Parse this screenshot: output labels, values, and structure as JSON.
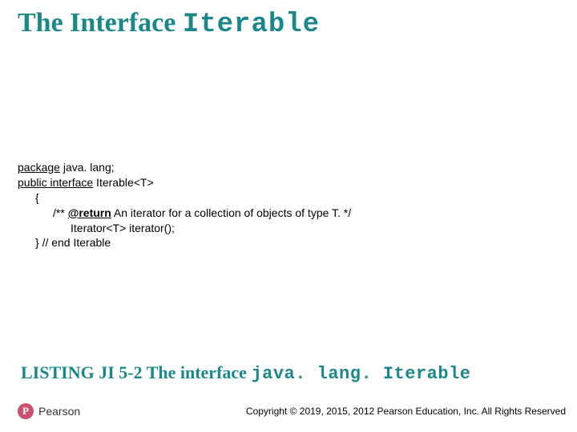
{
  "title": {
    "prefix": "The Interface ",
    "mono": "Iterable"
  },
  "code": {
    "l1a": "package",
    "l1b": " java. lang;",
    "l2a": "public interface",
    "l2b": " Iterable<T>",
    "l3": "{",
    "l4a": "/** ",
    "l4b": "@return",
    "l4c": " An iterator for a collection of objects of type T. */",
    "l5": "Iterator<T> iterator();",
    "l6": "} // end Iterable"
  },
  "listing": {
    "prefix": "LISTING JI 5-2 The interface ",
    "mono": "java. lang. Iterable"
  },
  "footer": {
    "logo_mark": "P",
    "logo_text": "Pearson",
    "copyright": "Copyright © 2019, 2015, 2012 Pearson Education, Inc. All Rights Reserved"
  }
}
